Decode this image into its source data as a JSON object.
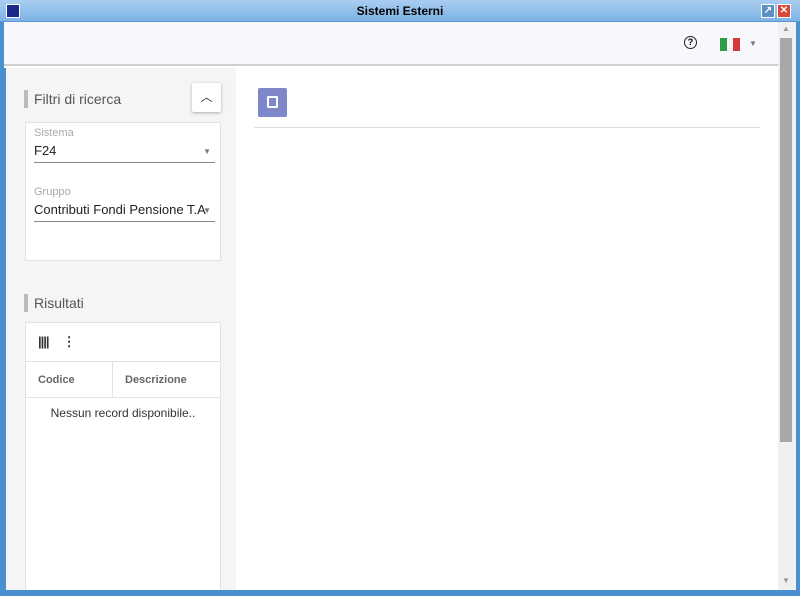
{
  "window": {
    "title": "Sistemi Esterni"
  },
  "header": {
    "help_icon": "?"
  },
  "filters": {
    "title": "Filtri di ricerca",
    "sistema": {
      "label": "Sistema",
      "value": "F24"
    },
    "gruppo": {
      "label": "Gruppo",
      "value": "Contributi Fondi Pensione T.A"
    }
  },
  "results": {
    "title": "Risultati",
    "columns": [
      "Codice",
      "Descrizione"
    ],
    "empty_text": "Nessun record disponibile.."
  },
  "colors": {
    "accent": "#7e87c9",
    "titlebar": "#7db3e6"
  }
}
